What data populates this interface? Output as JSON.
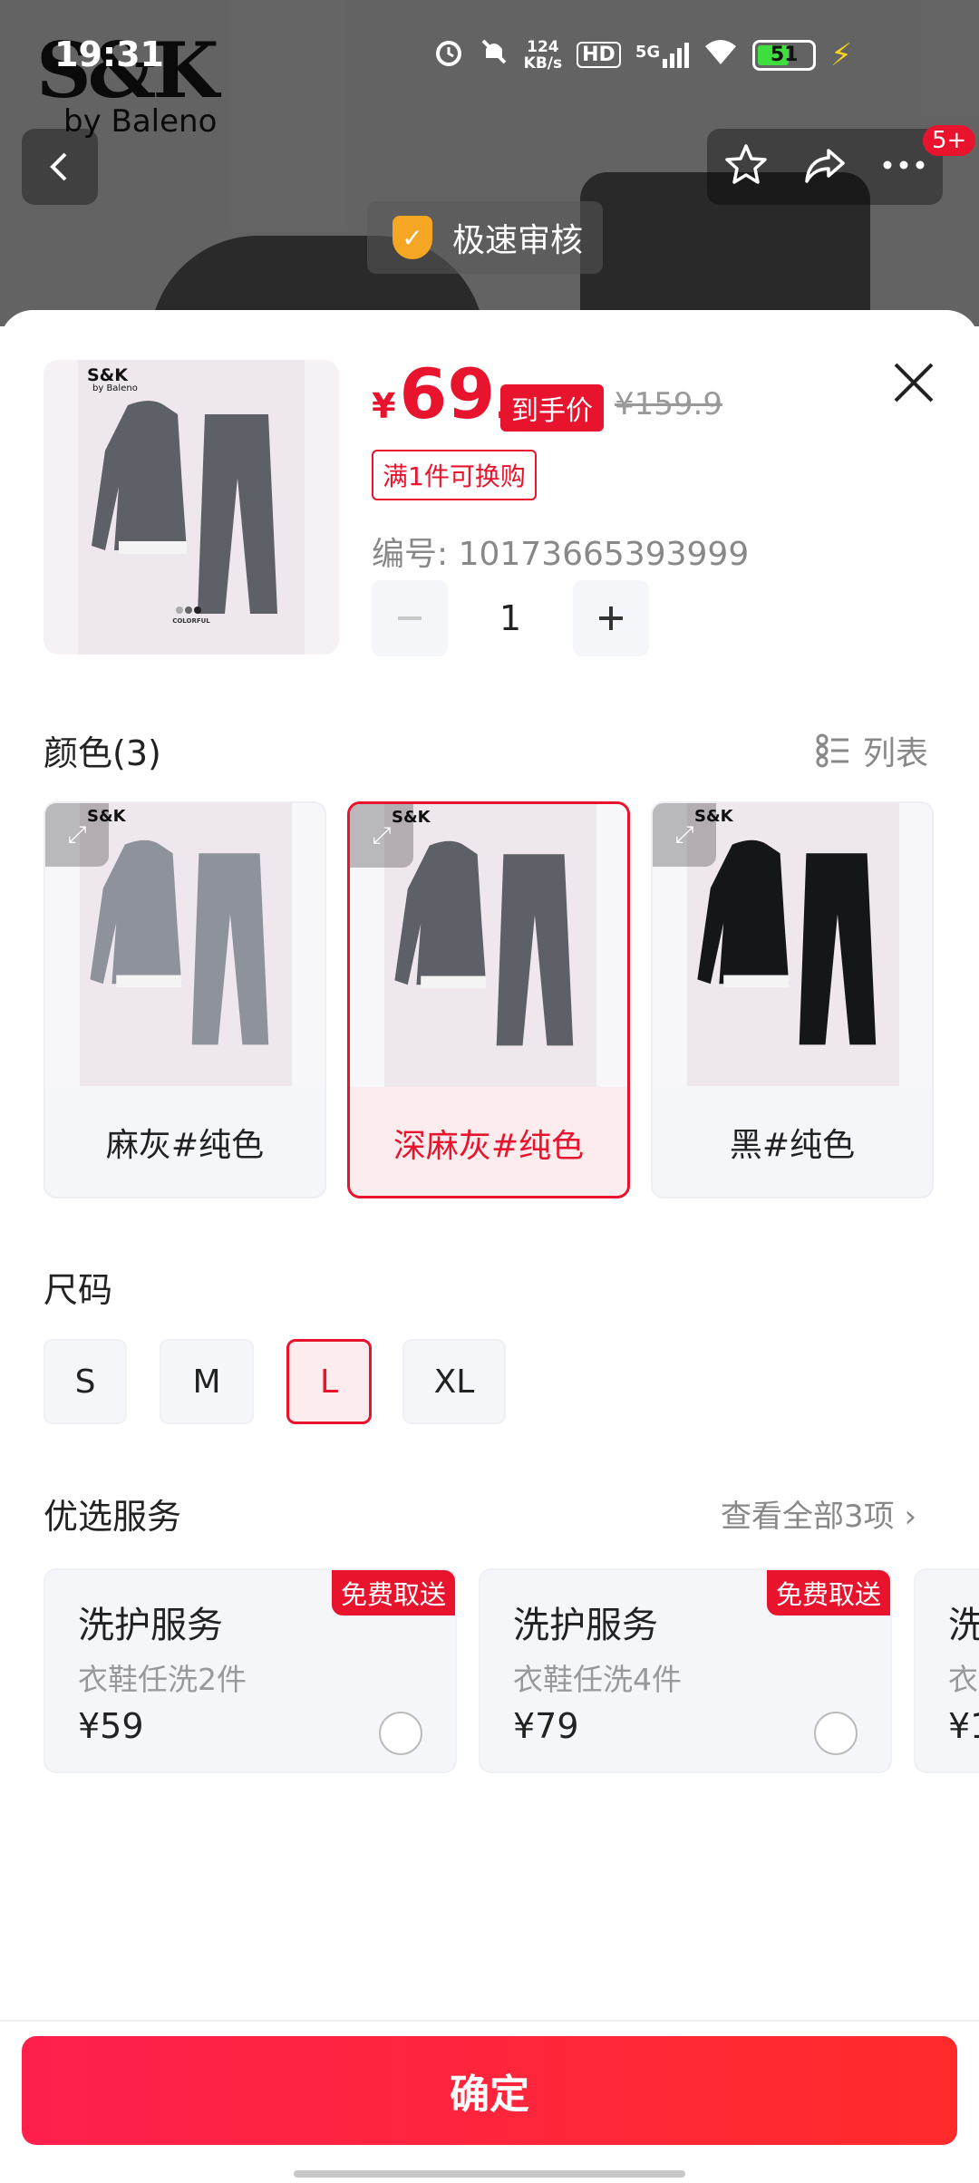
{
  "status_bar": {
    "time": "19:31",
    "net_speed_value": "124",
    "net_speed_unit": "KB/s",
    "hd": "HD",
    "signal": "5G",
    "battery": "51"
  },
  "background": {
    "brand_name": "S&K",
    "brand_sub": "by Baleno",
    "fast_review_label": "极速审核",
    "notification_badge": "5+"
  },
  "product": {
    "currency": "¥",
    "price_int": "69",
    "price_dec": ".9",
    "price_tag": "到手价",
    "original_price": "¥159.9",
    "promo": "满1件可换购",
    "sku_label": "编号: 10173665393999",
    "quantity": "1",
    "thumb_brand": "S&K",
    "thumb_brand_sub": "by Baleno",
    "thumb_caption": "COLORFUL"
  },
  "colors": {
    "title": "颜色(3)",
    "toggle_label": "列表",
    "items": [
      {
        "label": "麻灰#纯色",
        "selected": false,
        "garment": "#8e939b"
      },
      {
        "label": "深麻灰#纯色",
        "selected": true,
        "garment": "#5d6066"
      },
      {
        "label": "黑#纯色",
        "selected": false,
        "garment": "#15161a"
      }
    ]
  },
  "sizes": {
    "title": "尺码",
    "items": [
      {
        "label": "S",
        "selected": false
      },
      {
        "label": "M",
        "selected": false
      },
      {
        "label": "L",
        "selected": true
      },
      {
        "label": "XL",
        "selected": false
      }
    ]
  },
  "services": {
    "title": "优选服务",
    "view_all": "查看全部3项 ›",
    "items": [
      {
        "badge": "免费取送",
        "title": "洗护服务",
        "subtitle": "衣鞋任洗2件",
        "price": "¥59"
      },
      {
        "badge": "免费取送",
        "title": "洗护服务",
        "subtitle": "衣鞋任洗4件",
        "price": "¥79"
      },
      {
        "badge": "",
        "title": "洗",
        "subtitle": "衣",
        "price": "¥1"
      }
    ]
  },
  "footer": {
    "confirm_label": "确定"
  },
  "colors_theme": {
    "accent": "#e8142d",
    "muted_text": "#888888"
  }
}
